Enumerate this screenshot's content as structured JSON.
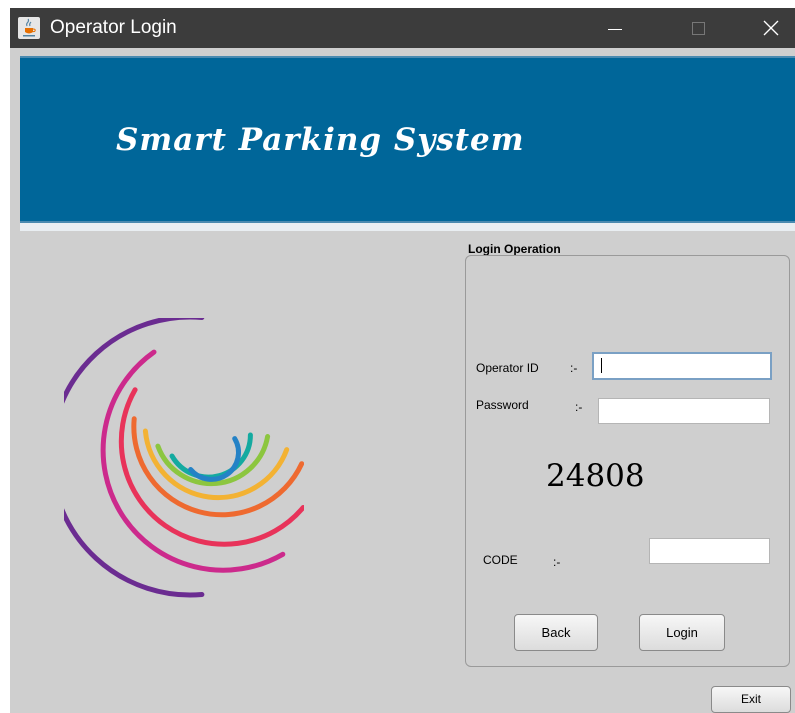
{
  "window": {
    "title": "Operator Login",
    "icon": "java-coffee-icon"
  },
  "banner": {
    "title": "Smart Parking System",
    "color": "#006699"
  },
  "login": {
    "group_title": "Login Operation",
    "operator_id_label": "Operator ID",
    "operator_id_sep": ":-",
    "operator_id_value": "",
    "password_label": "Password",
    "password_sep": ":-",
    "password_value": "",
    "captcha": "24808",
    "code_label": "CODE",
    "code_sep": ":-",
    "code_value": "",
    "back_label": "Back",
    "login_label": "Login"
  },
  "exit_label": "Exit",
  "logo": {
    "arc_colors": [
      "#6b2c91",
      "#cc2a8c",
      "#e8335a",
      "#ee6a30",
      "#f3b233",
      "#8cc63f",
      "#14aaa0",
      "#2482c6"
    ]
  }
}
